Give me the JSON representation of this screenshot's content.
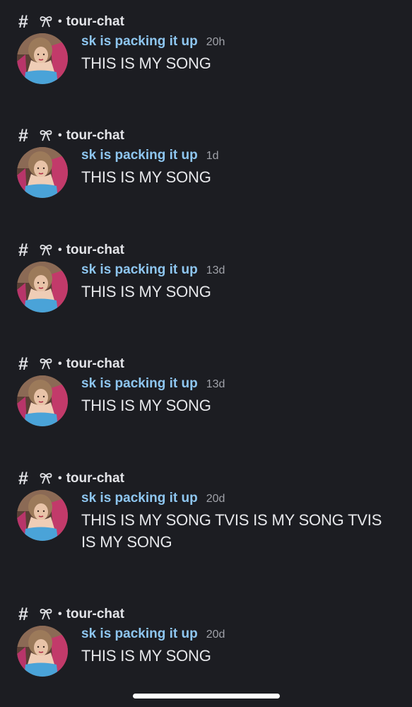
{
  "results": [
    {
      "channel_symbol": "#",
      "channel_separator": "•",
      "channel_name": "tour-chat",
      "author": "sk is packing it up",
      "time": "20h",
      "content": "THIS IS MY SONG"
    },
    {
      "channel_symbol": "#",
      "channel_separator": "•",
      "channel_name": "tour-chat",
      "author": "sk is packing it up",
      "time": "1d",
      "content": "THIS IS MY SONG"
    },
    {
      "channel_symbol": "#",
      "channel_separator": "•",
      "channel_name": "tour-chat",
      "author": "sk is packing it up",
      "time": "13d",
      "content": "THIS IS MY SONG"
    },
    {
      "channel_symbol": "#",
      "channel_separator": "•",
      "channel_name": "tour-chat",
      "author": "sk is packing it up",
      "time": "13d",
      "content": "THIS IS MY SONG"
    },
    {
      "channel_symbol": "#",
      "channel_separator": "•",
      "channel_name": "tour-chat",
      "author": "sk is packing it up",
      "time": "20d",
      "content": "THIS IS MY SONG TVIS IS MY SONG TVIS IS MY SONG"
    },
    {
      "channel_symbol": "#",
      "channel_separator": "•",
      "channel_name": "tour-chat",
      "author": "sk is packing it up",
      "time": "20d",
      "content": "THIS IS MY SONG"
    }
  ],
  "icons": {
    "channel": "hash-icon",
    "emoji": "bow-icon",
    "avatar": "user-avatar"
  },
  "colors": {
    "background": "#1c1d22",
    "author": "#8ec6f0",
    "text": "#e6e7ea",
    "timestamp": "#a0a2a9"
  }
}
